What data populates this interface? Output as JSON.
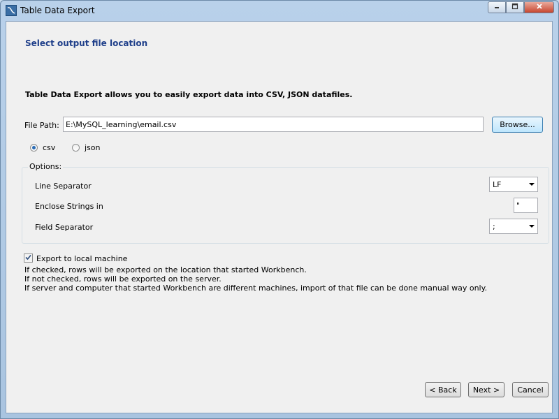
{
  "window": {
    "title": "Table Data Export",
    "controls": {
      "minimize": "▭",
      "maximize": "□",
      "close": "✕"
    }
  },
  "header": {
    "title": "Select output file location"
  },
  "intro": "Table Data Export allows you to easily export data into CSV, JSON datafiles.",
  "file_path": {
    "label": "File Path:",
    "value": "E:\\MySQL_learning\\email.csv",
    "browse_label": "Browse..."
  },
  "format": {
    "selected": "csv",
    "options": [
      {
        "label": "csv",
        "checked": true
      },
      {
        "label": "json",
        "checked": false
      }
    ]
  },
  "options": {
    "legend": "Options:",
    "line_separator": {
      "label": "Line Separator",
      "value": "LF"
    },
    "enclose_strings": {
      "label": "Enclose Strings in",
      "value": "\""
    },
    "field_separator": {
      "label": "Field Separator",
      "value": ";"
    }
  },
  "export_local": {
    "label": "Export to local machine",
    "checked": true,
    "help": [
      "If checked, rows will be exported on the location that started Workbench.",
      "If not checked, rows will be exported on the server.",
      "If server and computer that started Workbench are different machines, import of that file can be done manual way only."
    ]
  },
  "nav": {
    "back_label": "< Back",
    "next_label": "Next >",
    "cancel_label": "Cancel"
  },
  "colors": {
    "header_title": "#1f3f8a",
    "window_frame": "#b9d1ea",
    "client_bg": "#f0f0f0"
  },
  "icons": {
    "app": "mysql-workbench-icon",
    "minimize": "minimize-icon",
    "maximize": "maximize-icon",
    "close": "close-icon"
  }
}
